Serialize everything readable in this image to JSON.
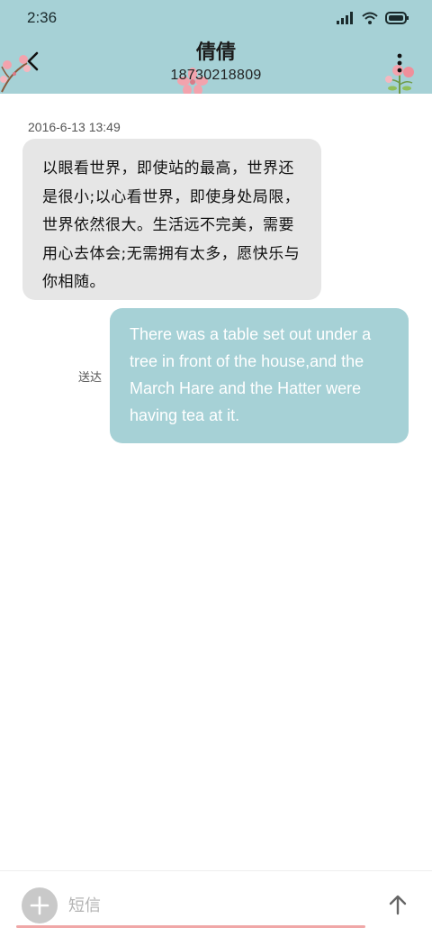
{
  "status_bar": {
    "time": "2:36",
    "icons": [
      "signal-icon",
      "wifi-icon",
      "battery-icon"
    ]
  },
  "header": {
    "contact_name": "倩倩",
    "contact_phone": "18730218809",
    "back_icon": "back-arrow-icon",
    "more_icon": "more-vertical-icon",
    "background_color": "#a6d1d6"
  },
  "conversation": {
    "timestamp": "2016-6-13 13:49",
    "messages": [
      {
        "direction": "incoming",
        "text": "以眼看世界，即使站的最高，世界还是很小;以心看世界，即使身处局限，世界依然很大。生活远不完美，需要用心去体会;无需拥有太多，愿快乐与你相随。",
        "bubble_color": "#e6e6e6"
      },
      {
        "direction": "outgoing",
        "text": "There was a table set out under a tree in front of the house,and the March Hare and the Hatter were having tea at it.",
        "status": "送达",
        "bubble_color": "#a6d1d6"
      }
    ]
  },
  "composer": {
    "placeholder": "短信",
    "value": "",
    "attach_icon": "plus-icon",
    "send_icon": "send-arrow-up-icon",
    "underline_color": "#f0a7a7"
  }
}
